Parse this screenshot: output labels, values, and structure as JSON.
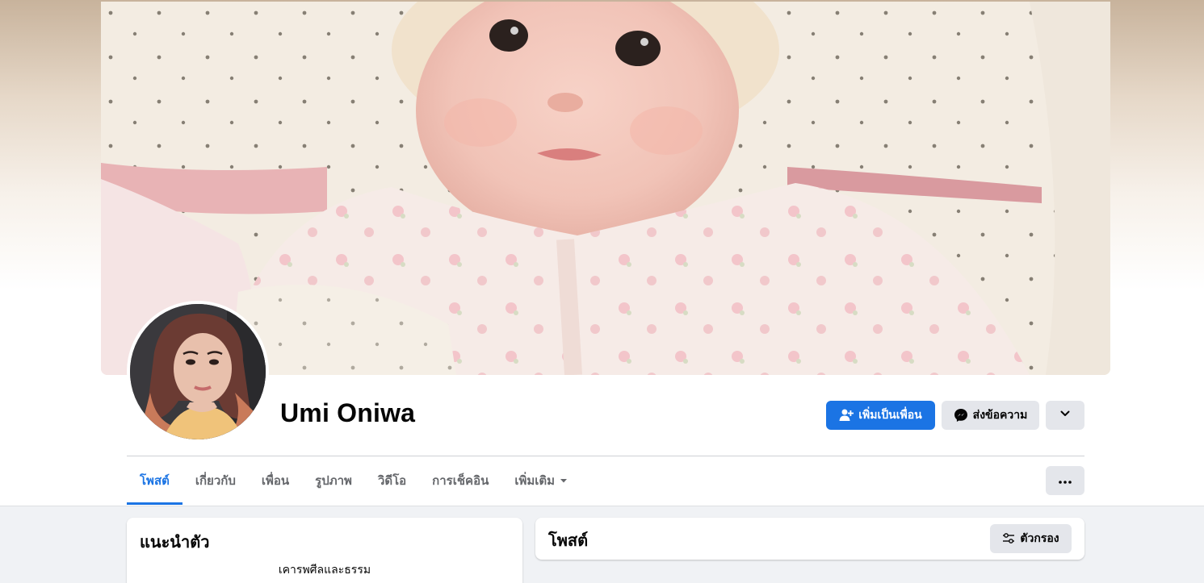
{
  "profile": {
    "name": "Umi Oniwa"
  },
  "actions": {
    "add_friend_label": "เพิ่มเป็นเพื่อน",
    "message_label": "ส่งข้อความ"
  },
  "tabs": [
    {
      "label": "โพสต์",
      "active": true
    },
    {
      "label": "เกี่ยวกับ",
      "active": false
    },
    {
      "label": "เพื่อน",
      "active": false
    },
    {
      "label": "รูปภาพ",
      "active": false
    },
    {
      "label": "วิดีโอ",
      "active": false
    },
    {
      "label": "การเช็คอิน",
      "active": false
    },
    {
      "label": "เพิ่มเติม",
      "active": false
    }
  ],
  "intro": {
    "title": "แนะนำตัว",
    "bio": "เคารพศีลและธรรม"
  },
  "posts": {
    "title": "โพสต์",
    "filter_label": "ตัวกรอง"
  },
  "colors": {
    "accent": "#1b74e4",
    "secondary_button": "#e4e6eb",
    "muted_text": "#65676b",
    "feed_background": "#f0f2f5"
  },
  "icons": {
    "add_friend": "person-plus-icon",
    "message": "messenger-icon",
    "more_actions": "chevron-down-icon",
    "tab_more": "caret-down-icon",
    "tabs_more": "ellipsis-icon",
    "filter": "sliders-icon"
  }
}
